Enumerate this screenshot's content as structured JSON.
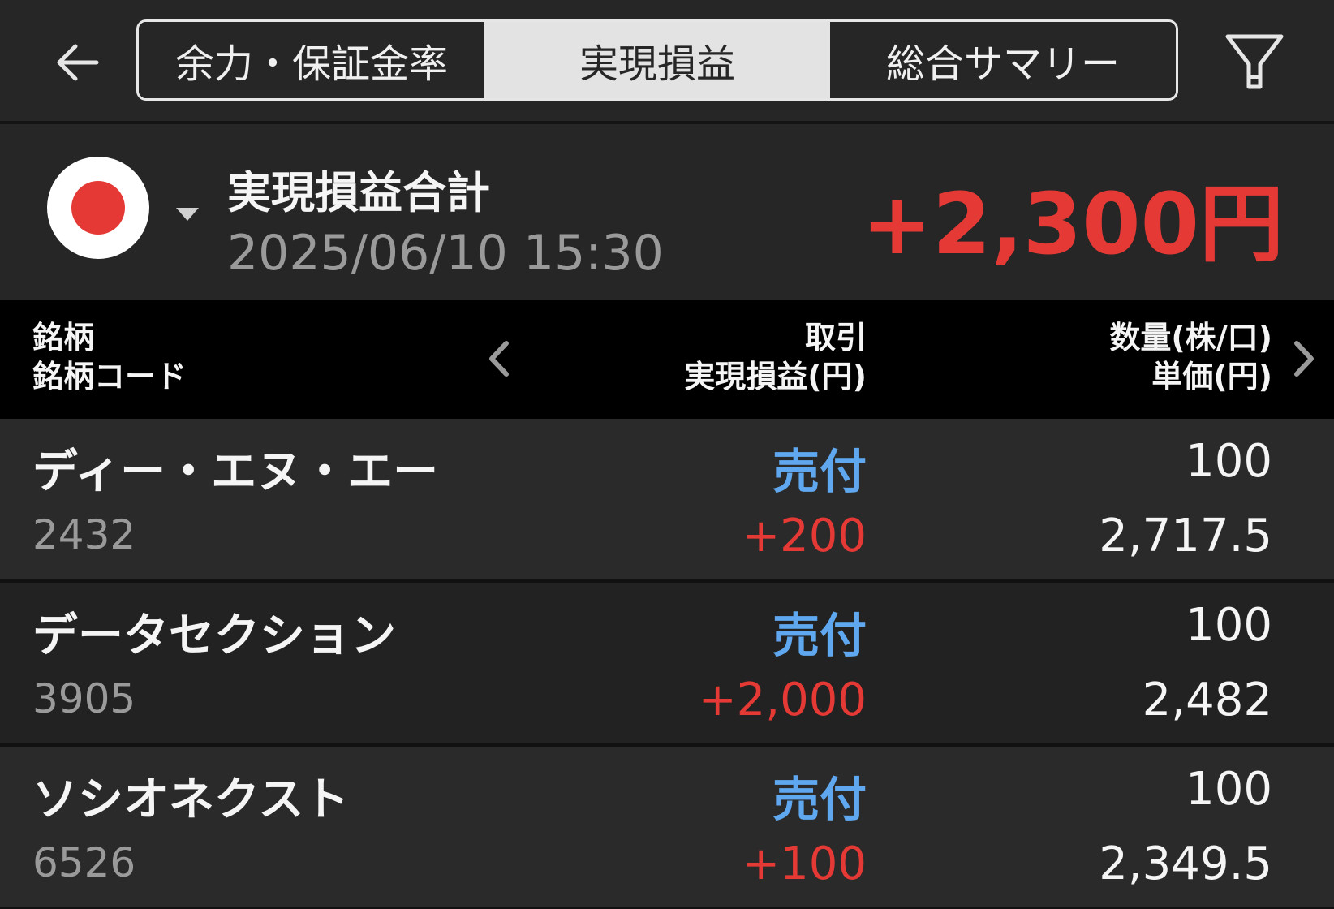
{
  "header": {
    "back_icon": "arrow-left-icon",
    "filter_icon": "filter-icon",
    "tabs": [
      {
        "label": "余力・保証金率",
        "active": false
      },
      {
        "label": "実現損益",
        "active": true
      },
      {
        "label": "総合サマリー",
        "active": false
      }
    ]
  },
  "summary": {
    "flag_icon": "japan-flag-icon",
    "title": "実現損益合計",
    "datetime": "2025/06/10  15:30",
    "total": "+2,300円",
    "total_color": "#e53935"
  },
  "columns": {
    "left_line1": "銘柄",
    "left_line2": "銘柄コード",
    "mid_line1": "取引",
    "mid_line2": "実現損益(円)",
    "right_line1": "数量(株/口)",
    "right_line2": "単価(円)"
  },
  "rows": [
    {
      "name": "ディー・エヌ・エー",
      "code": "2432",
      "trade": "売付",
      "pnl": "+200",
      "qty": "100",
      "price": "2,717.5"
    },
    {
      "name": "データセクション",
      "code": "3905",
      "trade": "売付",
      "pnl": "+2,000",
      "qty": "100",
      "price": "2,482"
    },
    {
      "name": "ソシオネクスト",
      "code": "6526",
      "trade": "売付",
      "pnl": "+100",
      "qty": "100",
      "price": "2,349.5"
    }
  ],
  "colors": {
    "background": "#262626",
    "accent_sell": "#5fa8f0",
    "profit": "#e53935"
  }
}
